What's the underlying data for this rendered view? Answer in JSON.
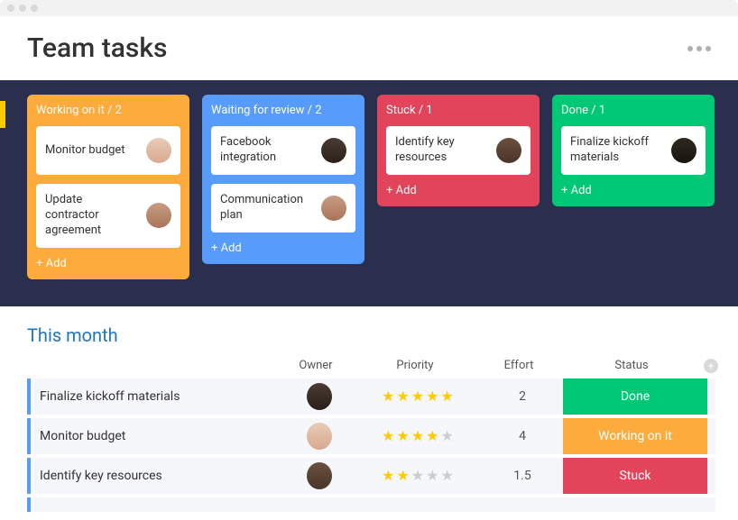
{
  "page_title": "Team tasks",
  "add_label": "+ Add",
  "colors": {
    "working": "#fdab3d",
    "waiting": "#579bfc",
    "stuck": "#e2445c",
    "done": "#00c875"
  },
  "columns": [
    {
      "key": "working",
      "header": "Working on it / 2",
      "cards": [
        {
          "title": "Monitor budget",
          "avatar": "a"
        },
        {
          "title": "Update contractor agreement",
          "avatar": "c"
        }
      ]
    },
    {
      "key": "waiting",
      "header": "Waiting for review / 2",
      "cards": [
        {
          "title": "Facebook integration",
          "avatar": "b"
        },
        {
          "title": "Communication plan",
          "avatar": "c"
        }
      ]
    },
    {
      "key": "stuck",
      "header": "Stuck / 1",
      "cards": [
        {
          "title": "Identify key resources",
          "avatar": "d"
        }
      ]
    },
    {
      "key": "done",
      "header": "Done / 1",
      "cards": [
        {
          "title": "Finalize kickoff materials",
          "avatar": "e"
        }
      ]
    }
  ],
  "section_title": "This month",
  "table_headers": {
    "owner": "Owner",
    "priority": "Priority",
    "effort": "Effort",
    "status": "Status"
  },
  "rows": [
    {
      "task": "Finalize kickoff materials",
      "avatar": "b",
      "stars": 5,
      "effort": "2",
      "status_key": "done",
      "status_label": "Done"
    },
    {
      "task": "Monitor budget",
      "avatar": "a",
      "stars": 4,
      "effort": "4",
      "status_key": "working",
      "status_label": "Working on it"
    },
    {
      "task": "Identify key resources",
      "avatar": "d",
      "stars": 2,
      "effort": "1.5",
      "status_key": "stuck",
      "status_label": "Stuck"
    }
  ]
}
